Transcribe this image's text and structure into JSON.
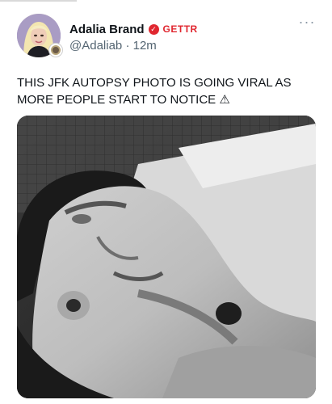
{
  "post": {
    "author": {
      "display_name": "Adalia Brand",
      "handle": "@Adaliab",
      "verified_icon": "verified-badge-icon",
      "source_label": "GETTR"
    },
    "time_separator": "·",
    "timestamp": "12m",
    "more_label": "···",
    "text_line1": "THIS JFK AUTOPSY PHOTO IS GOING VIRAL AS",
    "text_line2": "MORE PEOPLE START TO NOTICE ⚠"
  },
  "colors": {
    "accent": "#e0262f",
    "text": "#0f1419",
    "muted": "#536471"
  }
}
